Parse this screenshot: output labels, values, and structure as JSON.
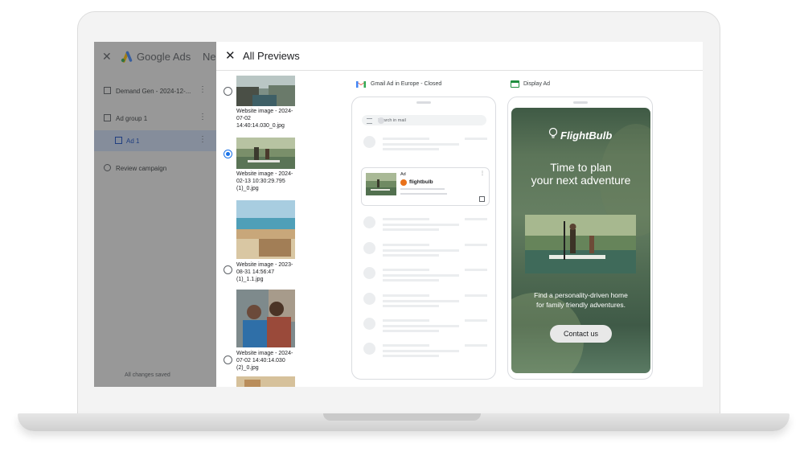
{
  "ads": {
    "close": "✕",
    "brand": "Google Ads",
    "tab_partial": "Ne",
    "nav": [
      {
        "label": "Demand Gen - 2024-12-..."
      },
      {
        "label": "Ad group 1"
      },
      {
        "label": "Ad 1"
      },
      {
        "label": "Review campaign"
      }
    ],
    "footer": "All changes saved"
  },
  "dialog": {
    "close": "✕",
    "title": "All Previews"
  },
  "images": [
    {
      "caption": "Website image - 2024-07-02 14:40:14.030_0.jpg",
      "selected": false
    },
    {
      "caption": "Website image - 2024-02-13 10:30:29.795 (1)_0.jpg",
      "selected": true
    },
    {
      "caption": "Website image - 2023-08-31 14:56:47 (1)_1.1.jpg",
      "selected": false
    },
    {
      "caption": "Website image - 2024-07-02 14:40:14.030 (2)_0.jpg",
      "selected": false
    }
  ],
  "gmail_preview": {
    "title": "Gmail Ad in Europe - Closed",
    "search_placeholder": "Search in mail",
    "ad_tag": "Ad",
    "ad_brand": "flightbulb",
    "more": "⋮"
  },
  "display_preview": {
    "title": "Display Ad",
    "brand": "FlightBulb",
    "headline_line1": "Time to plan",
    "headline_line2": "your next adventure",
    "body_line1": "Find a personality-driven home",
    "body_line2": "for family friendly adventures.",
    "cta": "Contact us"
  },
  "colors": {
    "accent_blue": "#1a73e8",
    "selected_nav": "#c9d6ee",
    "display_bg": "#4f6a52",
    "brand_orange": "#e8711a"
  }
}
